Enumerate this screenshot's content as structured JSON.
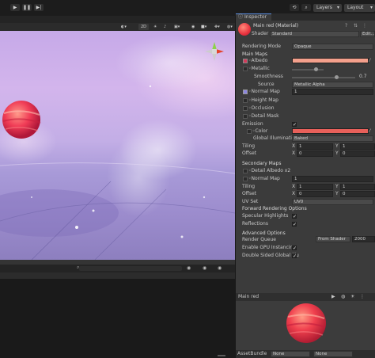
{
  "toolbar": {
    "play_icon": "play-icon",
    "pause_icon": "pause-icon",
    "step_icon": "step-icon",
    "layers_label": "Layers",
    "layout_label": "Layout"
  },
  "scene_toolbar": {
    "mode_2d": "2D"
  },
  "inspector": {
    "tab_label": "Inspector",
    "material_name": "Main red (Material)",
    "shader_label": "Shader",
    "shader_value": "Standard",
    "edit_label": "Edit...",
    "rendering_mode_label": "Rendering Mode",
    "rendering_mode_value": "Opaque",
    "main_maps_label": "Main Maps",
    "albedo_label": "Albedo",
    "albedo_color": "#f4a08c",
    "metallic_label": "Metallic",
    "smoothness_label": "Smoothness",
    "smoothness_value": "0.7",
    "smoothness_level": 0.7,
    "source_label": "Source",
    "source_value": "Metallic Alpha",
    "normal_map_label": "Normal Map",
    "normal_map_value": "1",
    "height_map_label": "Height Map",
    "occlusion_label": "Occlusion",
    "detail_mask_label": "Detail Mask",
    "emission_label": "Emission",
    "color_label": "Color",
    "emission_color": "#e8605a",
    "global_illum_label": "Global Illumination",
    "global_illum_value": "Baked",
    "tiling_label": "Tiling",
    "offset_label": "Offset",
    "x_label": "X",
    "y_label": "Y",
    "tiling_x": "1",
    "tiling_y": "1",
    "offset_x": "0",
    "offset_y": "0",
    "secondary_maps_label": "Secondary Maps",
    "detail_albedo_label": "Detail Albedo x2",
    "normal_map2_label": "Normal Map",
    "normal_map2_value": "1",
    "tiling2_x": "1",
    "tiling2_y": "1",
    "offset2_x": "0",
    "offset2_y": "0",
    "uv_set_label": "UV Set",
    "uv_set_value": "UV0",
    "forward_label": "Forward Rendering Options",
    "specular_label": "Specular Highlights",
    "reflections_label": "Reflections",
    "advanced_label": "Advanced Options",
    "render_queue_label": "Render Queue",
    "render_queue_mode": "From Shader",
    "render_queue_value": "2000",
    "gpu_instancing_label": "Enable GPU Instancing",
    "double_sided_label": "Double Sided Global Illu",
    "check_mark": "✓"
  },
  "preview": {
    "title": "Main red"
  },
  "asset_bundle": {
    "label": "AssetBundle",
    "value1": "None",
    "value2": "None"
  }
}
